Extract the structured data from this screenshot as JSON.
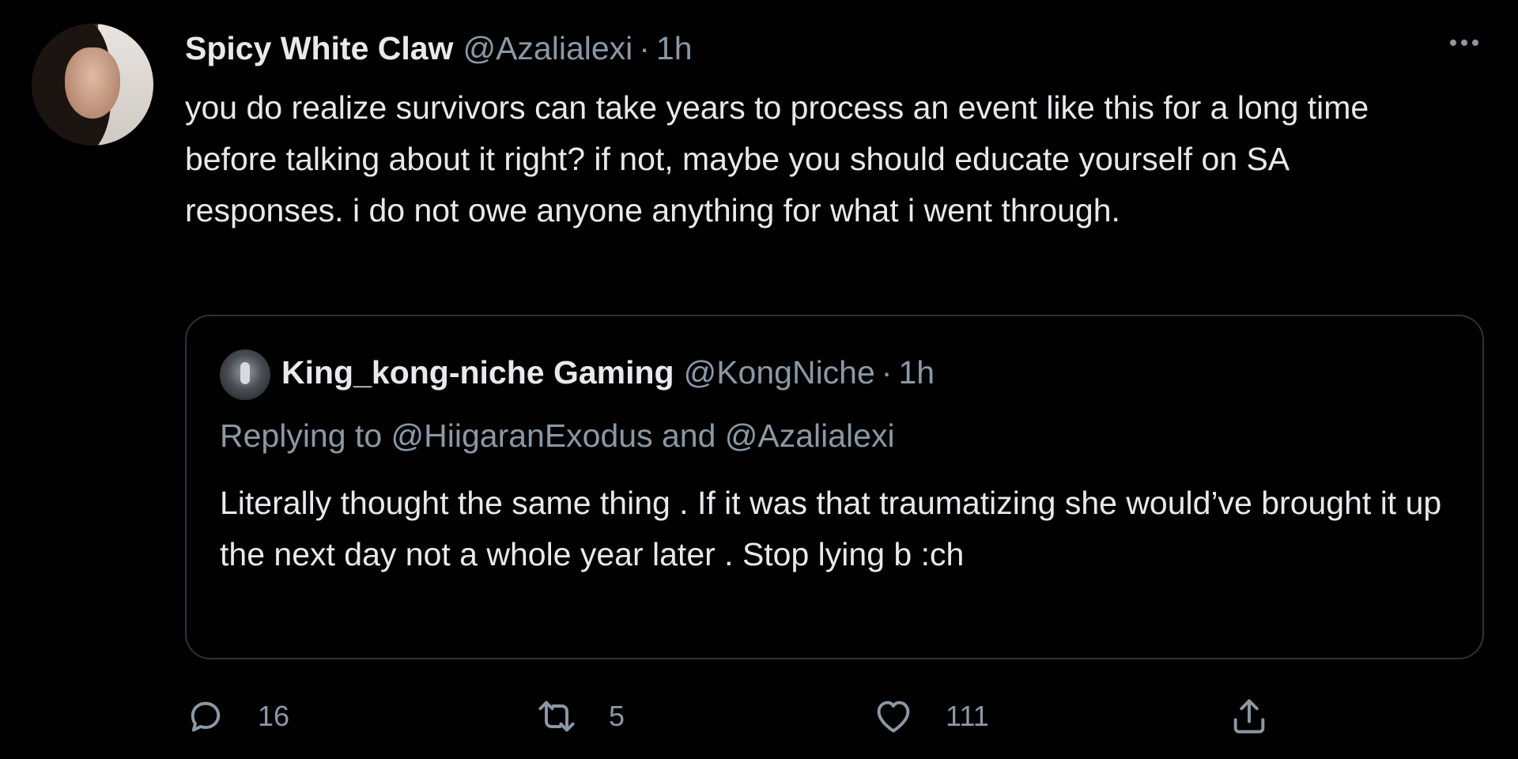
{
  "tweet": {
    "display_name": "Spicy White Claw",
    "handle": "@Azalialexi",
    "separator": "·",
    "time": "1h",
    "text": "you do realize survivors can take years to process an event like this for a long time before talking about it right? if not, maybe you should educate yourself on SA responses. i do not owe anyone anything for what i went through."
  },
  "quoted": {
    "display_name": "King_kong-niche Gaming",
    "handle": "@KongNiche",
    "separator": "·",
    "time": "1h",
    "replying_to": "Replying to @HiigaranExodus and @Azalialexi",
    "text": "Literally thought the same thing . If it was that traumatizing she would’ve brought it up the next day not a whole year later . Stop lying b :ch"
  },
  "actions": {
    "reply_count": "16",
    "retweet_count": "5",
    "like_count": "111"
  },
  "icons": {
    "more": "more-options-icon",
    "reply": "reply-icon",
    "retweet": "retweet-icon",
    "like": "heart-icon",
    "share": "share-icon"
  },
  "colors": {
    "background": "#000000",
    "text": "#e7e9ea",
    "secondary": "#8b98a5",
    "border": "#2f3336"
  }
}
